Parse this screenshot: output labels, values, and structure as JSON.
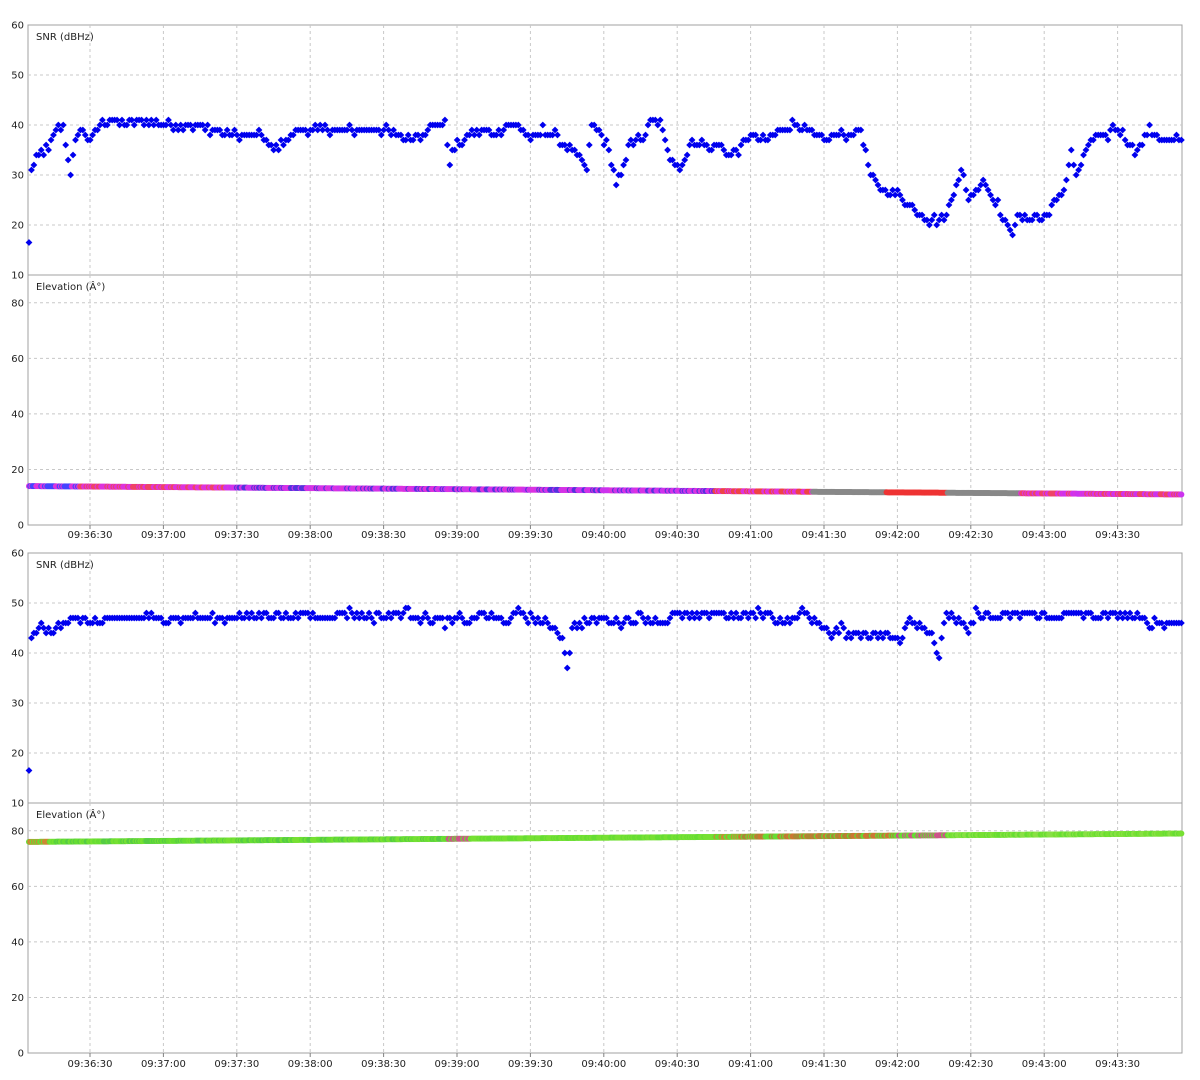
{
  "chart_data": [
    {
      "type": "scatter",
      "title": "SNR (dBHz)",
      "ylim": [
        10,
        60
      ],
      "yticks": [
        10,
        20,
        30,
        40,
        50,
        60
      ],
      "xticks": [
        "09:36:30",
        "09:37:00",
        "09:37:30",
        "09:38:00",
        "09:38:30",
        "09:39:00",
        "09:39:30",
        "09:40:00",
        "09:40:30",
        "09:41:00",
        "09:41:30",
        "09:42:00",
        "09:42:30",
        "09:43:00",
        "09:43:30"
      ],
      "xlim_s": [
        0,
        471
      ],
      "grid": true,
      "series": [
        {
          "color": "#0000ee",
          "keypoints": [
            [
              0,
              16.5
            ],
            [
              1,
              31
            ],
            [
              3,
              33
            ],
            [
              5,
              35
            ],
            [
              8,
              35
            ],
            [
              11,
              39
            ],
            [
              14,
              40
            ],
            [
              17,
              30
            ],
            [
              20,
              39
            ],
            [
              23,
              38
            ],
            [
              26,
              37
            ],
            [
              29,
              40
            ],
            [
              33,
              41
            ],
            [
              40,
              40
            ],
            [
              48,
              41
            ],
            [
              55,
              40
            ],
            [
              65,
              40
            ],
            [
              75,
              39
            ],
            [
              83,
              38
            ],
            [
              90,
              38
            ],
            [
              95,
              38
            ],
            [
              100,
              35
            ],
            [
              105,
              37
            ],
            [
              110,
              39
            ],
            [
              120,
              39
            ],
            [
              145,
              39
            ],
            [
              150,
              38
            ],
            [
              155,
              37
            ],
            [
              160,
              38
            ],
            [
              165,
              40
            ],
            [
              170,
              40
            ],
            [
              172,
              33
            ],
            [
              175,
              36
            ],
            [
              180,
              38
            ],
            [
              185,
              39
            ],
            [
              190,
              38
            ],
            [
              195,
              40
            ],
            [
              200,
              40
            ],
            [
              205,
              37
            ],
            [
              210,
              39
            ],
            [
              215,
              38
            ],
            [
              218,
              36
            ],
            [
              222,
              35
            ],
            [
              225,
              33
            ],
            [
              228,
              31
            ],
            [
              230,
              40
            ],
            [
              233,
              39
            ],
            [
              237,
              35
            ],
            [
              240,
              28
            ],
            [
              243,
              31
            ],
            [
              246,
              37
            ],
            [
              250,
              37
            ],
            [
              255,
              41
            ],
            [
              258,
              40
            ],
            [
              262,
              34
            ],
            [
              266,
              31
            ],
            [
              270,
              36
            ],
            [
              275,
              37
            ],
            [
              278,
              35
            ],
            [
              282,
              36
            ],
            [
              286,
              34
            ],
            [
              290,
              35
            ],
            [
              295,
              38
            ],
            [
              300,
              37
            ],
            [
              305,
              38
            ],
            [
              310,
              40
            ],
            [
              315,
              40
            ],
            [
              320,
              38
            ],
            [
              325,
              37
            ],
            [
              330,
              38
            ],
            [
              335,
              38
            ],
            [
              340,
              39
            ],
            [
              344,
              30
            ],
            [
              347,
              28
            ],
            [
              350,
              27
            ],
            [
              355,
              26
            ],
            [
              360,
              24
            ],
            [
              365,
              22
            ],
            [
              368,
              21
            ],
            [
              372,
              21
            ],
            [
              375,
              22
            ],
            [
              378,
              27
            ],
            [
              381,
              31
            ],
            [
              384,
              25
            ],
            [
              387,
              27
            ],
            [
              390,
              29
            ],
            [
              393,
              26
            ],
            [
              396,
              24
            ],
            [
              399,
              20
            ],
            [
              402,
              19
            ],
            [
              405,
              22
            ],
            [
              408,
              21
            ],
            [
              411,
              22
            ],
            [
              414,
              21
            ],
            [
              417,
              23
            ],
            [
              420,
              25
            ],
            [
              423,
              27
            ],
            [
              426,
              35
            ],
            [
              428,
              30
            ],
            [
              431,
              33
            ],
            [
              434,
              37
            ],
            [
              437,
              38
            ],
            [
              440,
              37
            ],
            [
              443,
              40
            ],
            [
              446,
              39
            ],
            [
              449,
              37
            ],
            [
              452,
              35
            ],
            [
              455,
              36
            ],
            [
              458,
              39
            ],
            [
              461,
              38
            ],
            [
              464,
              37
            ],
            [
              468,
              37
            ],
            [
              471,
              37
            ]
          ]
        }
      ]
    },
    {
      "type": "scatter",
      "title": "Elevation (Â°)",
      "ylim": [
        0,
        90
      ],
      "yticks": [
        0,
        20,
        40,
        60,
        80
      ],
      "xticks": [
        "09:36:30",
        "09:37:00",
        "09:37:30",
        "09:38:00",
        "09:38:30",
        "09:39:00",
        "09:39:30",
        "09:40:00",
        "09:40:30",
        "09:41:00",
        "09:41:30",
        "09:42:00",
        "09:42:30",
        "09:43:00",
        "09:43:30"
      ],
      "xlim_s": [
        0,
        471
      ],
      "grid": true,
      "series": [
        {
          "value_range": [
            14,
            11
          ],
          "color_segments": [
            {
              "from": 0,
              "to": 20,
              "colors": [
                "#4444ff",
                "#dd33dd"
              ]
            },
            {
              "from": 20,
              "to": 80,
              "colors": [
                "#ee4466",
                "#dd33dd"
              ]
            },
            {
              "from": 80,
              "to": 280,
              "colors": [
                "#dd33dd",
                "#cc33ee",
                "#5533dd"
              ]
            },
            {
              "from": 280,
              "to": 320,
              "colors": [
                "#ee4444",
                "#dd33dd"
              ]
            },
            {
              "from": 320,
              "to": 350,
              "colors": [
                "#888888"
              ]
            },
            {
              "from": 350,
              "to": 375,
              "colors": [
                "#ee3333"
              ]
            },
            {
              "from": 375,
              "to": 405,
              "colors": [
                "#888888"
              ]
            },
            {
              "from": 405,
              "to": 471,
              "colors": [
                "#dd33dd",
                "#cc33ee",
                "#ee4466"
              ]
            }
          ]
        }
      ]
    },
    {
      "type": "scatter",
      "title": "SNR (dBHz)",
      "ylim": [
        10,
        60
      ],
      "yticks": [
        10,
        20,
        30,
        40,
        50,
        60
      ],
      "xticks": [
        "09:36:30",
        "09:37:00",
        "09:37:30",
        "09:38:00",
        "09:38:30",
        "09:39:00",
        "09:39:30",
        "09:40:00",
        "09:40:30",
        "09:41:00",
        "09:41:30",
        "09:42:00",
        "09:42:30",
        "09:43:00",
        "09:43:30"
      ],
      "xlim_s": [
        0,
        471
      ],
      "grid": true,
      "series": [
        {
          "color": "#0000ee",
          "keypoints": [
            [
              0,
              16.5
            ],
            [
              1,
              43
            ],
            [
              4,
              45
            ],
            [
              9,
              44
            ],
            [
              12,
              46
            ],
            [
              15,
              46
            ],
            [
              20,
              47
            ],
            [
              30,
              46
            ],
            [
              40,
              47
            ],
            [
              60,
              47
            ],
            [
              80,
              47
            ],
            [
              85,
              48
            ],
            [
              90,
              47
            ],
            [
              100,
              48
            ],
            [
              105,
              47
            ],
            [
              115,
              48
            ],
            [
              120,
              47
            ],
            [
              130,
              48
            ],
            [
              140,
              47
            ],
            [
              155,
              48
            ],
            [
              160,
              47
            ],
            [
              170,
              46
            ],
            [
              175,
              47
            ],
            [
              180,
              46
            ],
            [
              185,
              48
            ],
            [
              190,
              47
            ],
            [
              195,
              46
            ],
            [
              200,
              48
            ],
            [
              205,
              47
            ],
            [
              210,
              46
            ],
            [
              215,
              45
            ],
            [
              218,
              43
            ],
            [
              220,
              37
            ],
            [
              222,
              45
            ],
            [
              225,
              46
            ],
            [
              232,
              47
            ],
            [
              240,
              46
            ],
            [
              250,
              47
            ],
            [
              260,
              46
            ],
            [
              265,
              48
            ],
            [
              270,
              47
            ],
            [
              280,
              48
            ],
            [
              290,
              47
            ],
            [
              300,
              48
            ],
            [
              310,
              46
            ],
            [
              315,
              48
            ],
            [
              320,
              47
            ],
            [
              325,
              45
            ],
            [
              328,
              43
            ],
            [
              331,
              45
            ],
            [
              335,
              44
            ],
            [
              345,
              44
            ],
            [
              352,
              43
            ],
            [
              356,
              43
            ],
            [
              360,
              47
            ],
            [
              363,
              46
            ],
            [
              366,
              45
            ],
            [
              369,
              44
            ],
            [
              372,
              39
            ],
            [
              375,
              48
            ],
            [
              378,
              47
            ],
            [
              381,
              46
            ],
            [
              384,
              44
            ],
            [
              387,
              48
            ],
            [
              395,
              47
            ],
            [
              410,
              48
            ],
            [
              420,
              47
            ],
            [
              430,
              48
            ],
            [
              440,
              47
            ],
            [
              450,
              48
            ],
            [
              456,
              46
            ],
            [
              460,
              46
            ],
            [
              471,
              46
            ]
          ]
        }
      ]
    },
    {
      "type": "scatter",
      "title": "Elevation (Â°)",
      "ylim": [
        0,
        90
      ],
      "yticks": [
        0,
        20,
        40,
        60,
        80
      ],
      "xticks": [
        "09:36:30",
        "09:37:00",
        "09:37:30",
        "09:38:00",
        "09:38:30",
        "09:39:00",
        "09:39:30",
        "09:40:00",
        "09:40:30",
        "09:41:00",
        "09:41:30",
        "09:42:00",
        "09:42:30",
        "09:43:00",
        "09:43:30"
      ],
      "xlim_s": [
        0,
        471
      ],
      "grid": true,
      "series": [
        {
          "value_range": [
            76,
            79
          ],
          "color_segments": [
            {
              "from": 0,
              "to": 8,
              "colors": [
                "#cc8833",
                "#66dd33"
              ]
            },
            {
              "from": 8,
              "to": 170,
              "colors": [
                "#66dd33",
                "#55cc44",
                "#77e033"
              ]
            },
            {
              "from": 170,
              "to": 180,
              "colors": [
                "#cc5588",
                "#66dd33"
              ]
            },
            {
              "from": 180,
              "to": 280,
              "colors": [
                "#66dd33",
                "#77e033"
              ]
            },
            {
              "from": 280,
              "to": 290,
              "colors": [
                "#cc8833",
                "#66dd33"
              ]
            },
            {
              "from": 290,
              "to": 355,
              "colors": [
                "#66dd33",
                "#aa8833",
                "#cc7733"
              ]
            },
            {
              "from": 355,
              "to": 375,
              "colors": [
                "#66dd33",
                "#cc5588"
              ]
            },
            {
              "from": 375,
              "to": 471,
              "colors": [
                "#66dd33",
                "#77e033",
                "#88e044"
              ]
            }
          ]
        }
      ]
    }
  ]
}
